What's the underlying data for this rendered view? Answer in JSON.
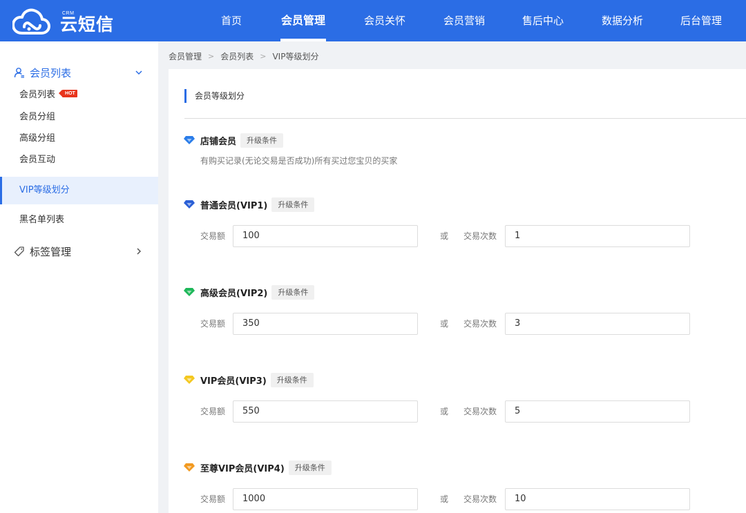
{
  "brand": {
    "name": "云短信",
    "tag": "CRM"
  },
  "nav": [
    {
      "label": "首页"
    },
    {
      "label": "会员管理",
      "active": true
    },
    {
      "label": "会员关怀"
    },
    {
      "label": "会员营销"
    },
    {
      "label": "售后中心"
    },
    {
      "label": "数据分析"
    },
    {
      "label": "后台管理"
    }
  ],
  "sidebar": {
    "group_members": {
      "label": "会员列表",
      "expanded": true
    },
    "items": [
      {
        "label": "会员列表",
        "badge": "HOT"
      },
      {
        "label": "会员分组"
      },
      {
        "label": "高级分组"
      },
      {
        "label": "会员互动"
      },
      {
        "label": "VIP等级划分",
        "active": true
      },
      {
        "label": "黑名单列表"
      }
    ],
    "group_tags": {
      "label": "标签管理",
      "expanded": false
    }
  },
  "breadcrumb": [
    "会员管理",
    "会员列表",
    "VIP等级划分"
  ],
  "panel": {
    "title": "会员等级划分"
  },
  "labels": {
    "amount": "交易额",
    "or": "或",
    "count": "交易次数",
    "condition": "升级条件"
  },
  "tiers": [
    {
      "name": "店铺会员",
      "gem_color": "#2b7de9",
      "description": "有购买记录(无论交易是否成功)所有买过您宝贝的买家"
    },
    {
      "name": "普通会员(VIP1)",
      "gem_color": "#2a5fd6",
      "amount": "100",
      "count": "1"
    },
    {
      "name": "高级会员(VIP2)",
      "gem_color": "#1fb85a",
      "amount": "350",
      "count": "3"
    },
    {
      "name": "VIP会员(VIP3)",
      "gem_color": "#f4c821",
      "amount": "550",
      "count": "5"
    },
    {
      "name": "至尊VIP会员(VIP4)",
      "gem_color": "#f29a21",
      "amount": "1000",
      "count": "10"
    }
  ]
}
